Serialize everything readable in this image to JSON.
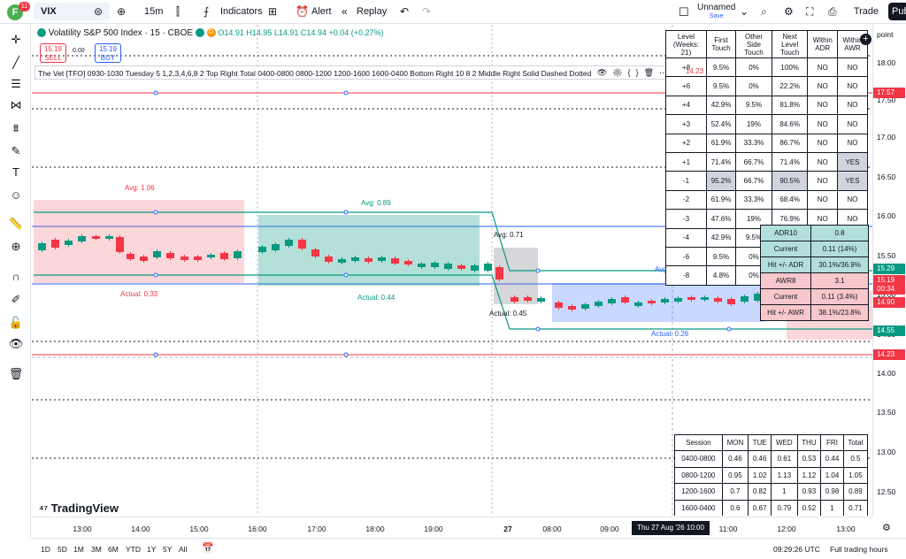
{
  "topbar": {
    "avatar_letter": "F",
    "badge": "11",
    "symbol": "VIX",
    "interval": "15m",
    "indicators": "Indicators",
    "alert": "Alert",
    "replay": "Replay",
    "layout_name": "Unnamed",
    "save_label": "Save",
    "trade": "Trade",
    "publish": "Pub"
  },
  "legend": {
    "title": "Volatility S&P 500 Index · 15 · CBOE",
    "ohlc": "O14.91  H14.95  L14.91  C14.94  +0.04 (+0.27%)",
    "sell_price": "15.19",
    "sell_label": "SELL",
    "spread": "0.00",
    "buy_price": "15.19",
    "buy_label": "BUY"
  },
  "indicator_line": "The Vet [TFO] 0930-1030 Tuesday 5 1,2,3,4,6,8 2 Top Right Total 0400-0800 0800-1200 1200-1600 1600-0400 Bottom Right 10 8 2 Middle Right Solid Dashed Dotted",
  "box_labels": {
    "avg1": "Avg: 1.06",
    "actual1": "Actual: 0.33",
    "avg2": "Avg: 0.89",
    "actual2": "Actual: 0.44",
    "avg3": "Avg: 0.71",
    "actual3": "Actual: 0.45",
    "avg4": "Avg: 0.51",
    "actual4": "Actual: 0.26"
  },
  "level_table": {
    "headers": [
      "Level (Weeks: 21)",
      "First Touch",
      "Other Side Touch",
      "Next Level Touch",
      "Within ADR",
      "Within AWR"
    ],
    "rows": [
      [
        "+8",
        "9.5%",
        "0%",
        "100%",
        "NO",
        "NO"
      ],
      [
        "+6",
        "9.5%",
        "0%",
        "22.2%",
        "NO",
        "NO"
      ],
      [
        "+4",
        "42.9%",
        "9.5%",
        "81.8%",
        "NO",
        "NO"
      ],
      [
        "+3",
        "52.4%",
        "19%",
        "84.6%",
        "NO",
        "NO"
      ],
      [
        "+2",
        "61.9%",
        "33.3%",
        "86.7%",
        "NO",
        "NO"
      ],
      [
        "+1",
        "71.4%",
        "66.7%",
        "71.4%",
        "NO",
        "YES"
      ],
      [
        "-1",
        "95.2%",
        "66.7%",
        "90.5%",
        "NO",
        "YES"
      ],
      [
        "-2",
        "61.9%",
        "33.3%",
        "68.4%",
        "NO",
        "NO"
      ],
      [
        "-3",
        "47.6%",
        "19%",
        "76.9%",
        "NO",
        "NO"
      ],
      [
        "-4",
        "42.9%",
        "9.5%",
        "90%",
        "NO",
        "NO"
      ],
      [
        "-6",
        "9.5%",
        "0%",
        "",
        "",
        ""
      ],
      [
        "-8",
        "4.8%",
        "0%",
        "",
        "",
        ""
      ]
    ]
  },
  "adr_table": {
    "rows": [
      [
        "ADR10",
        "0.8"
      ],
      [
        "Current",
        "0.11 (14%)"
      ],
      [
        "Hit +/- ADR",
        "30.1%/36.9%"
      ],
      [
        "AWR8",
        "3.1"
      ],
      [
        "Current",
        "0.11 (3.4%)"
      ],
      [
        "Hit +/- AWR",
        "38.1%/23.8%"
      ]
    ]
  },
  "session_table": {
    "headers": [
      "Session",
      "MON",
      "TUE",
      "WED",
      "THU",
      "FRI",
      "Total"
    ],
    "rows": [
      [
        "0400-0800",
        "0.46",
        "0.46",
        "0.61",
        "0.53",
        "0.44",
        "0.5"
      ],
      [
        "0800-1200",
        "0.95",
        "1.02",
        "1.13",
        "1.12",
        "1.04",
        "1.05"
      ],
      [
        "1200-1600",
        "0.7",
        "0.82",
        "1",
        "0.93",
        "0.98",
        "0.89"
      ],
      [
        "1600-0400",
        "0.6",
        "0.67",
        "0.79",
        "0.52",
        "1",
        "0.71"
      ]
    ]
  },
  "price_axis": {
    "unit": "point",
    "labels": [
      "18.00",
      "17.50",
      "17.00",
      "16.50",
      "16.00",
      "15.50",
      "15.00",
      "14.50",
      "14.00",
      "13.50",
      "13.00",
      "12.50"
    ],
    "tags": [
      {
        "text": "17.57",
        "color": "#f23645"
      },
      {
        "text": "15.29",
        "color": "#089981"
      },
      {
        "text": "15.19",
        "color": "#f23645"
      },
      {
        "text": "00:34",
        "color": "#f23645"
      },
      {
        "text": "14.90",
        "color": "#f23645"
      },
      {
        "text": "14.55",
        "color": "#089981"
      },
      {
        "text": "14.23",
        "color": "#f23645"
      }
    ],
    "crosshair_label": "14.23"
  },
  "time_axis": {
    "labels": [
      "13:00",
      "14:00",
      "15:00",
      "16:00",
      "17:00",
      "18:00",
      "19:00",
      "27",
      "08:00",
      "09:00",
      "11:00",
      "12:00",
      "13:00"
    ],
    "crosshair": "Thu 27 Aug '26   10:00"
  },
  "bottombar": {
    "ranges": [
      "1D",
      "5D",
      "1M",
      "3M",
      "6M",
      "YTD",
      "1Y",
      "5Y",
      "All"
    ],
    "clock": "09:29:26 UTC",
    "session": "Full trading hours"
  },
  "watermark": "TradingView",
  "colors": {
    "red": "#f23645",
    "green": "#089981",
    "blue": "#2962ff",
    "teal": "#26a69a"
  }
}
